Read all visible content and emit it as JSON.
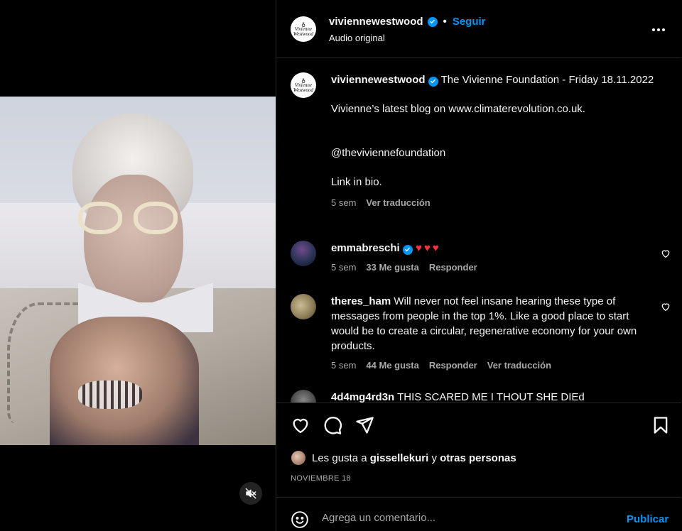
{
  "post": {
    "username": "viviennewestwood",
    "follow_label": "Seguir",
    "audio": "Audio original",
    "avatar_logo_top": "Vivienne",
    "avatar_logo_bottom": "Westwood",
    "caption_title": "The Vivienne Foundation - Friday 18.11.2022",
    "caption_line_1": "Vivienne’s latest blog on www.climaterevolution.co.uk.",
    "caption_line_2": "@theviviennefoundation",
    "caption_line_3": "Link in bio.",
    "caption_time": "5 sem",
    "caption_translate": "Ver traducción"
  },
  "comments": [
    {
      "username": "emmabreschi",
      "verified": true,
      "text": "♥♥♥",
      "time": "5 sem",
      "likes": "33 Me gusta",
      "reply": "Responder"
    },
    {
      "username": "theres_ham",
      "verified": false,
      "text": "Will never not feel insane hearing these type of messages from people in the top 1%. Like a good place to start would be to create a circular, regenerative economy for your own products.",
      "time": "5 sem",
      "likes": "44 Me gusta",
      "reply": "Responder",
      "translate": "Ver traducción"
    },
    {
      "username": "4d4mg4rd3n",
      "text": "THIS SCARED ME I THOUT SHE DIEd"
    }
  ],
  "actions": {
    "likes_prefix": "Les gusta a",
    "likes_user": "gissellekuri",
    "likes_join": "y",
    "likes_others": "otras personas",
    "date": "NOVIEMBRE 18"
  },
  "composer": {
    "placeholder": "Agrega un comentario...",
    "publish": "Publicar"
  },
  "colors": {
    "accent": "#0095f6",
    "heart": "#ff3040",
    "background": "#000000",
    "secondary_text": "#a8a8a8"
  },
  "icons": [
    "mute-icon",
    "more-icon",
    "verified-icon",
    "heart-icon",
    "comment-icon",
    "share-icon",
    "save-icon",
    "emoji-icon"
  ]
}
